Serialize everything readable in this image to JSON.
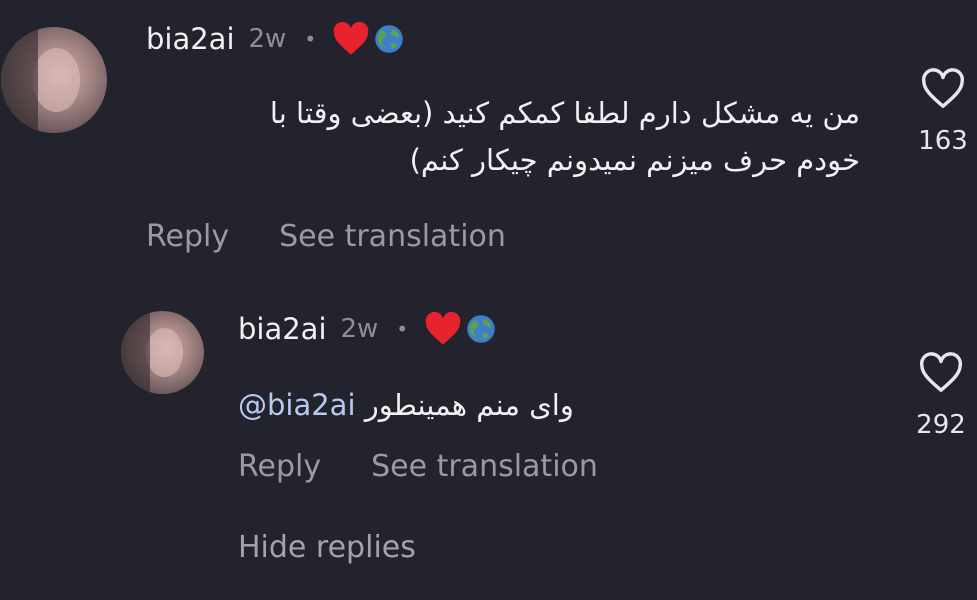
{
  "comments": [
    {
      "username": "bia2ai",
      "time": "2w",
      "separator": "•",
      "text_lines": [
        "من یه مشکل دارم لطفا کمکم کنید (بعضی وقتا با",
        "خودم حرف میزنم نمیدونم چیکار کنم)"
      ],
      "reply_label": "Reply",
      "translate_label": "See translation",
      "like_count": "163"
    },
    {
      "username": "bia2ai",
      "time": "2w",
      "separator": "•",
      "mention": "@bia2ai",
      "text": "وای منم همینطور",
      "reply_label": "Reply",
      "translate_label": "See translation",
      "like_count": "292"
    }
  ],
  "hide_replies_label": "Hide replies",
  "icons": [
    "heart-emoji",
    "globe-emoji",
    "heart-outline-icon"
  ],
  "colors": {
    "background": "#23232d",
    "heart": "#e8232d",
    "mention": "#b8c8ee"
  }
}
